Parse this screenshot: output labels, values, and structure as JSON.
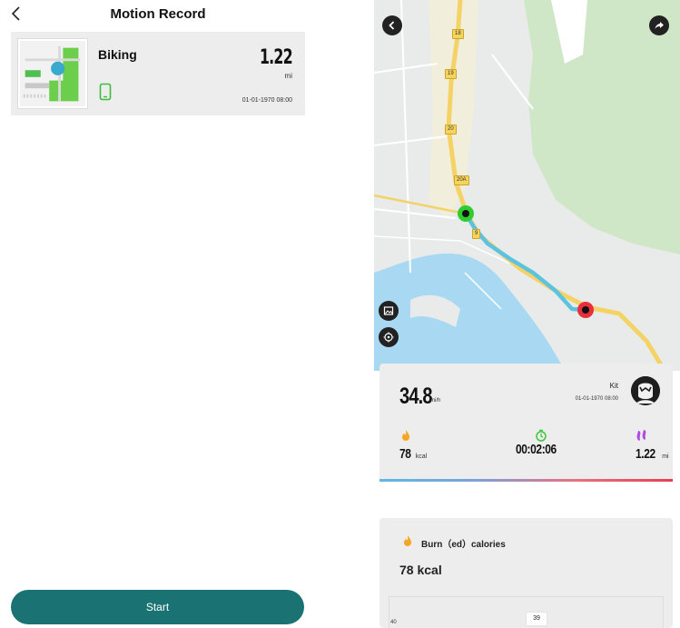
{
  "left": {
    "title": "Motion Record",
    "record": {
      "type": "Biking",
      "distance": "1.22",
      "unit": "mi",
      "date": "01-01-1970 08:00"
    },
    "start_label": "Start"
  },
  "right": {
    "road_labels": [
      "18",
      "19",
      "20",
      "20A",
      "9"
    ],
    "stats": {
      "speed": "34.8",
      "speed_unit": "mi/h",
      "user_name": "Kit",
      "date": "01-01-1970 08:00",
      "calories": "78",
      "calories_unit": "kcal",
      "duration": "00:02:06",
      "distance": "1.22",
      "distance_unit": "mi"
    },
    "burn": {
      "title": "Burn（ed）calories",
      "value": "78 kcal",
      "chart_y_tick": "40",
      "chart_tooltip": "39"
    }
  },
  "colors": {
    "start_button": "#1b7272",
    "route": "#5bc3e0",
    "start_marker": "#2ecc2e",
    "end_marker": "#e8303c",
    "flame": "#f5a623",
    "timer": "#3cc83c",
    "distance_icon": "#b04be0"
  }
}
